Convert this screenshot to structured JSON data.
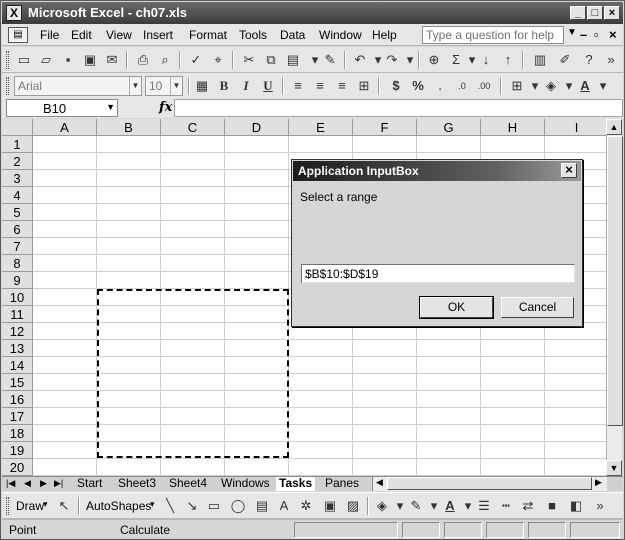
{
  "window": {
    "title": "Microsoft Excel - ch07.xls",
    "icon": "excel-icon",
    "controls": [
      "minimize",
      "maximize",
      "close"
    ]
  },
  "menu": {
    "items": [
      "File",
      "Edit",
      "View",
      "Insert",
      "Format",
      "Tools",
      "Data",
      "Window",
      "Help"
    ],
    "help_placeholder": "Type a question for help"
  },
  "formatting": {
    "font_name": "Arial",
    "font_size": "10"
  },
  "formula_bar": {
    "name_box": "B10",
    "fx_label": "fx",
    "formula": ""
  },
  "grid": {
    "columns": [
      "A",
      "B",
      "C",
      "D",
      "E",
      "F",
      "G",
      "H",
      "I"
    ],
    "rows": [
      "1",
      "2",
      "3",
      "4",
      "5",
      "6",
      "7",
      "8",
      "9",
      "10",
      "11",
      "12",
      "13",
      "14",
      "15",
      "16",
      "17",
      "18",
      "19",
      "20"
    ],
    "selection_marquee": "B10:D19"
  },
  "sheets": {
    "tabs": [
      "Start",
      "Sheet3",
      "Sheet4",
      "Windows",
      "Tasks",
      "Panes"
    ],
    "active": "Tasks"
  },
  "drawing": {
    "draw_label": "Draw",
    "autoshapes_label": "AutoShapes"
  },
  "status": {
    "mode": "Point",
    "calc": "Calculate"
  },
  "dialog": {
    "title": "Application InputBox",
    "prompt": "Select a range",
    "value": "$B$10:$D$19",
    "ok_label": "OK",
    "cancel_label": "Cancel"
  },
  "colors": {
    "titlebar": "#3c3c3c",
    "marquee": "#000000"
  }
}
